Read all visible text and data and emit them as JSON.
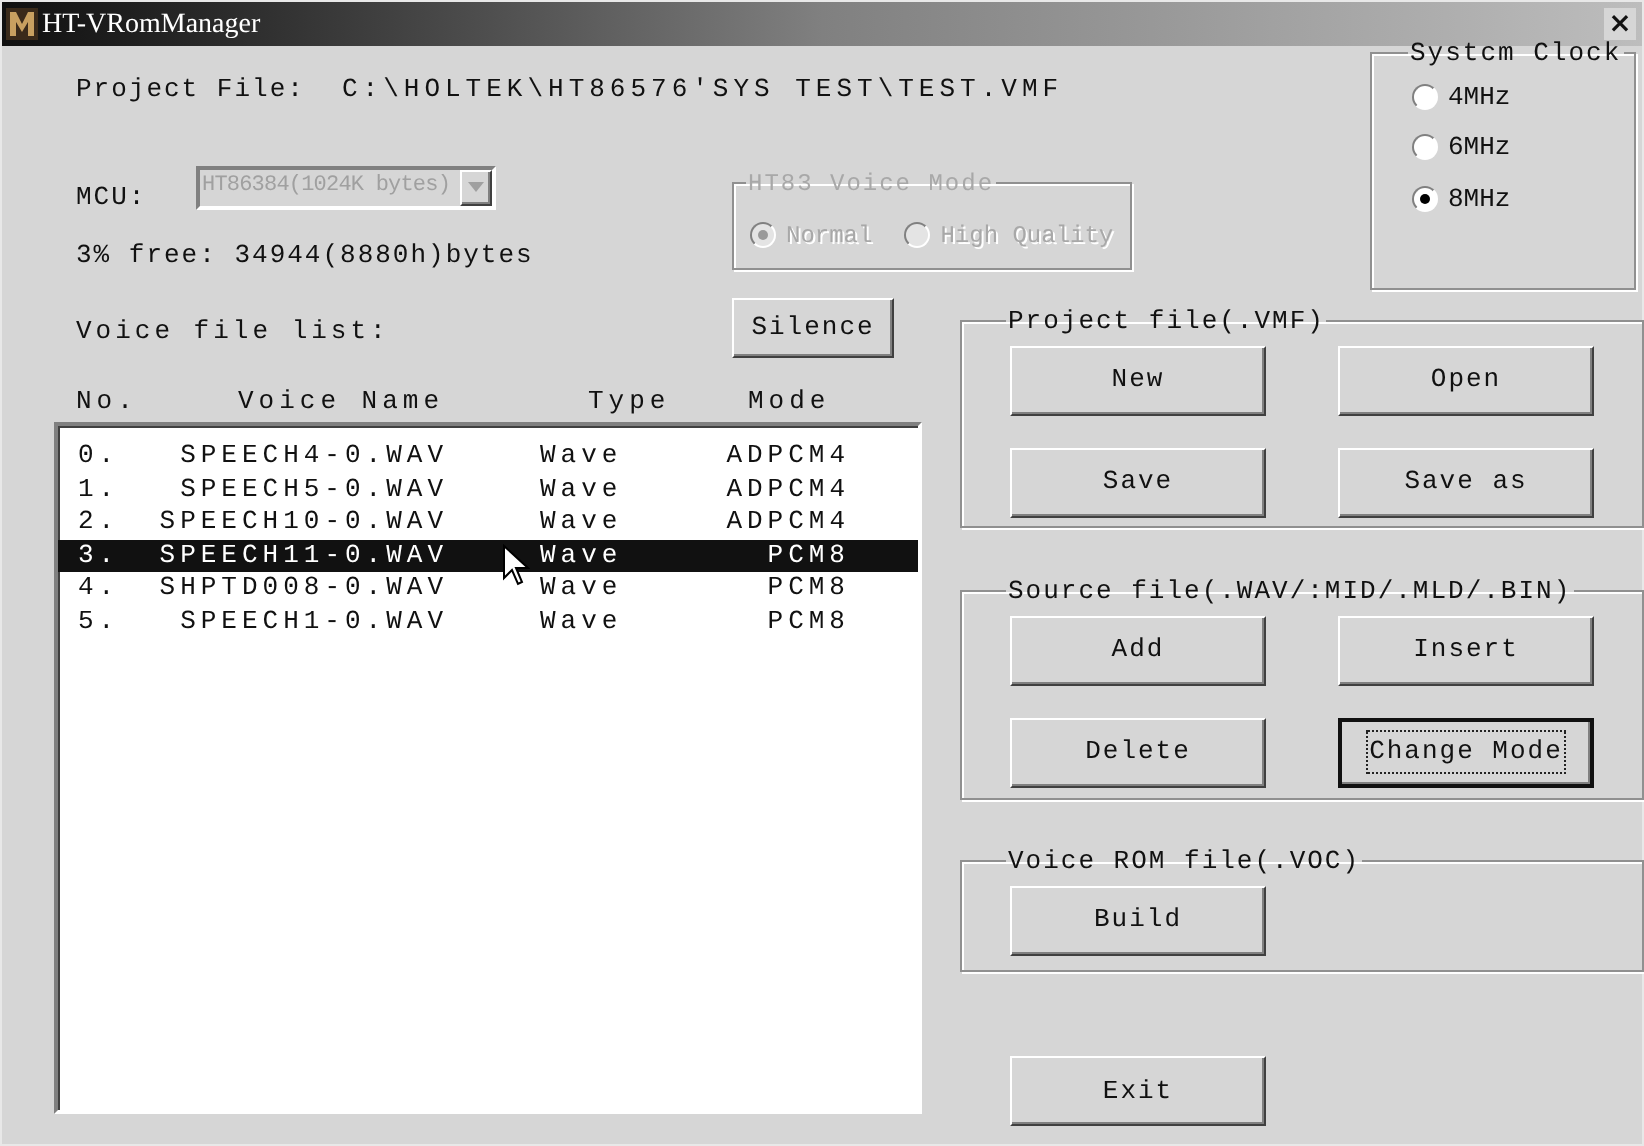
{
  "window": {
    "title": "HT-VRomManager",
    "close": "×"
  },
  "project_file": {
    "label": "Project File:",
    "path": "C:\\HOLTEK\\HT86576'SYS TEST\\TEST.VMF"
  },
  "mcu": {
    "label": "MCU:",
    "value": "HT86384(1024K bytes)",
    "disabled": true
  },
  "free_space": "3% free: 34944(8880h)bytes",
  "voice_mode": {
    "title": "HT83 Voice Mode",
    "disabled": true,
    "options": [
      {
        "label": "Normal",
        "selected": true
      },
      {
        "label": "High Quality",
        "selected": false
      }
    ]
  },
  "system_clock": {
    "title": "Systcm Clock",
    "options": [
      {
        "label": "4MHz",
        "selected": false
      },
      {
        "label": "6MHz",
        "selected": false
      },
      {
        "label": "8MHz",
        "selected": true
      }
    ]
  },
  "voice_file_list": {
    "label": "Voice file list:",
    "columns": [
      "No.",
      "Voice Name",
      "Type",
      "Mode"
    ],
    "rows": [
      {
        "no": "0.",
        "name": "SPEECH4-0.WAV",
        "type": "Wave",
        "mode": "ADPCM4",
        "selected": false
      },
      {
        "no": "1.",
        "name": "SPEECH5-0.WAV",
        "type": "Wave",
        "mode": "ADPCM4",
        "selected": false
      },
      {
        "no": "2.",
        "name": "SPEECH10-0.WAV",
        "type": "Wave",
        "mode": "ADPCM4",
        "selected": false
      },
      {
        "no": "3.",
        "name": "SPEECH11-0.WAV",
        "type": "Wave",
        "mode": "PCM8",
        "selected": true
      },
      {
        "no": "4.",
        "name": "SHPTD008-0.WAV",
        "type": "Wave",
        "mode": "PCM8",
        "selected": false
      },
      {
        "no": "5.",
        "name": "SPEECH1-0.WAV",
        "type": "Wave",
        "mode": "PCM8",
        "selected": false
      }
    ]
  },
  "silence_button": "Silence",
  "groups": [
    {
      "title": "Project file(.VMF)",
      "buttons": [
        {
          "label": "New",
          "focused": false
        },
        {
          "label": "Open",
          "focused": false
        },
        {
          "label": "Save",
          "focused": false
        },
        {
          "label": "Save as",
          "focused": false
        }
      ]
    },
    {
      "title": "Source file(.WAV/:MID/.MLD/.BIN)",
      "buttons": [
        {
          "label": "Add",
          "focused": false
        },
        {
          "label": "Insert",
          "focused": false
        },
        {
          "label": "Delete",
          "focused": false
        },
        {
          "label": "Change Mode",
          "focused": true
        }
      ]
    },
    {
      "title": "Voice ROM file(.VOC)",
      "buttons": [
        {
          "label": "Build",
          "focused": false
        }
      ]
    }
  ],
  "exit_button": "Exit"
}
